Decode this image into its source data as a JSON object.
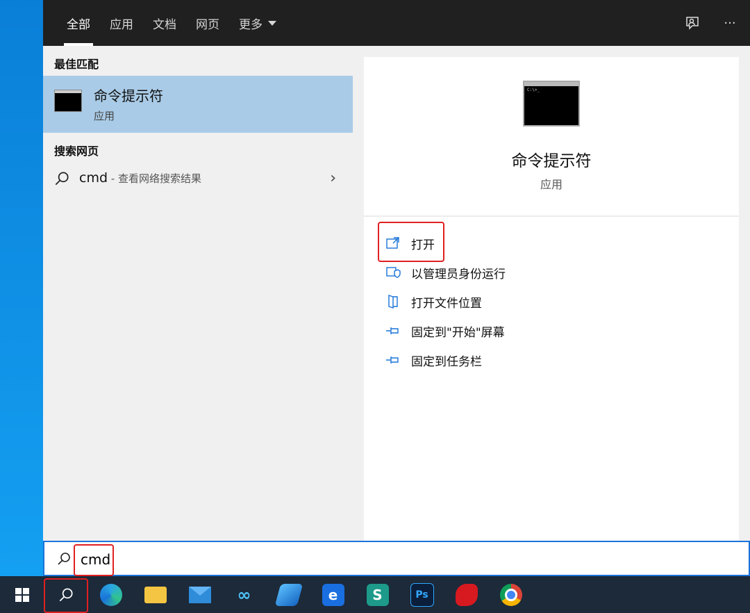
{
  "tabs": [
    {
      "label": "全部",
      "active": true
    },
    {
      "label": "应用"
    },
    {
      "label": "文档"
    },
    {
      "label": "网页"
    },
    {
      "label": "更多"
    }
  ],
  "top_icons": {
    "feedback": "feedback-icon",
    "more": "···"
  },
  "best_match": {
    "section_title": "最佳匹配",
    "title": "命令提示符",
    "subtitle": "应用"
  },
  "web_search": {
    "section_title": "搜索网页",
    "query": "cmd",
    "hint": " - 查看网络搜索结果"
  },
  "preview": {
    "title": "命令提示符",
    "subtitle": "应用",
    "actions": [
      {
        "label": "打开",
        "icon": "open-icon"
      },
      {
        "label": "以管理员身份运行",
        "icon": "admin-shield-icon"
      },
      {
        "label": "打开文件位置",
        "icon": "file-location-icon"
      },
      {
        "label": "固定到\"开始\"屏幕",
        "icon": "pin-icon"
      },
      {
        "label": "固定到任务栏",
        "icon": "pin-icon"
      }
    ]
  },
  "search": {
    "value": "cmd"
  },
  "taskbar": {
    "apps": [
      "windows-start",
      "search",
      "edge",
      "file-explorer",
      "mail",
      "infinity-app",
      "azure-app",
      "e-app",
      "s-app",
      "photoshop",
      "red-app",
      "chrome"
    ],
    "ps_label": "Ps"
  },
  "colors": {
    "accent": "#1a73d9",
    "highlight": "#e02020",
    "selected": "#a9cbe7"
  }
}
